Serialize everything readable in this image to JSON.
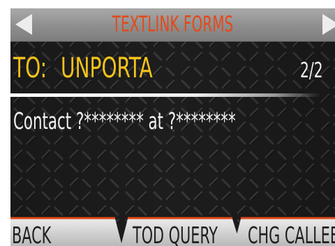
{
  "header": {
    "title": "TEXTLINK FORMS",
    "left_arrow_icon": "left-arrow-icon",
    "right_arrow_icon": "right-arrow-icon"
  },
  "recipient": {
    "label": "TO:",
    "name": "UNPORTA"
  },
  "page_counter": "2/2",
  "message": {
    "text": "Contact ?******** at ?********"
  },
  "softkeys": [
    {
      "label": "BACK"
    },
    {
      "label": "TOD QUERY"
    },
    {
      "label": "CHG CALLEE"
    }
  ],
  "colors": {
    "title": "#e24a1a",
    "recipient": "#f2c21b",
    "text": "#f2f2f2",
    "softkey_bg": "#d6d6d6",
    "softkey_accent": "#e24a1a"
  }
}
